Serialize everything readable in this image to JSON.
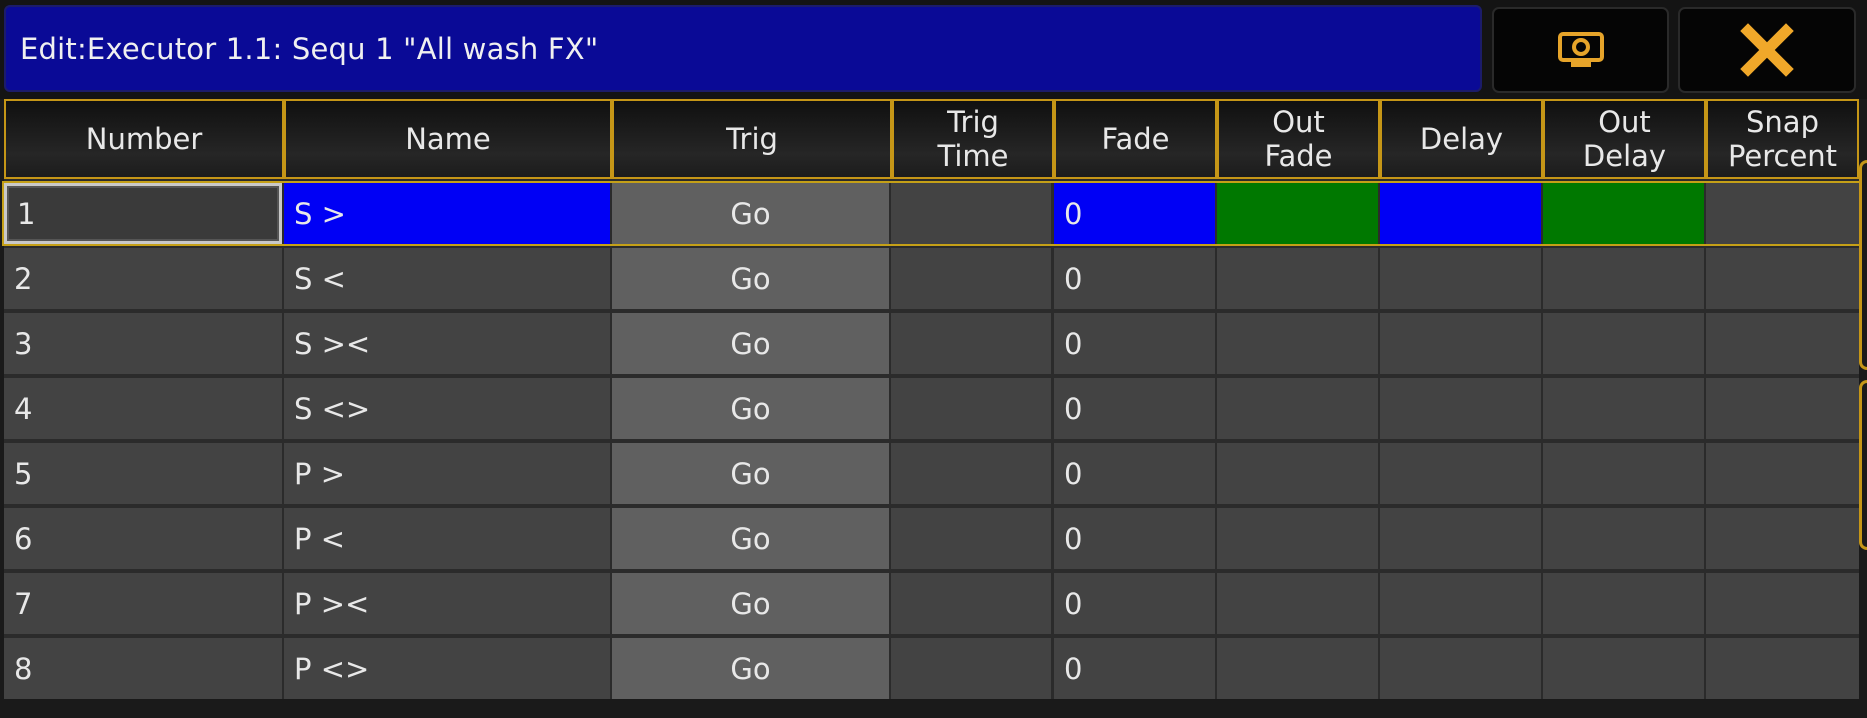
{
  "window": {
    "title": "Edit:Executor 1.1: Sequ 1 \"All wash FX\"",
    "view_button_icon": "view-icon",
    "close_button_icon": "close-icon"
  },
  "columns": [
    {
      "key": "number",
      "label": "Number"
    },
    {
      "key": "name",
      "label": "Name"
    },
    {
      "key": "trig",
      "label": "Trig"
    },
    {
      "key": "trig_time",
      "label": "Trig\nTime"
    },
    {
      "key": "fade",
      "label": "Fade"
    },
    {
      "key": "out_fade",
      "label": "Out\nFade"
    },
    {
      "key": "delay",
      "label": "Delay"
    },
    {
      "key": "out_delay",
      "label": "Out\nDelay"
    },
    {
      "key": "snap_percent",
      "label": "Snap\nPercent"
    }
  ],
  "rows": [
    {
      "number": "1",
      "name": "S >",
      "trig": "Go",
      "trig_time": "",
      "fade": "0",
      "out_fade": "",
      "delay": "",
      "out_delay": "",
      "snap_percent": ""
    },
    {
      "number": "2",
      "name": "S <",
      "trig": "Go",
      "trig_time": "",
      "fade": "0",
      "out_fade": "",
      "delay": "",
      "out_delay": "",
      "snap_percent": ""
    },
    {
      "number": "3",
      "name": "S ><",
      "trig": "Go",
      "trig_time": "",
      "fade": "0",
      "out_fade": "",
      "delay": "",
      "out_delay": "",
      "snap_percent": ""
    },
    {
      "number": "4",
      "name": "S <>",
      "trig": "Go",
      "trig_time": "",
      "fade": "0",
      "out_fade": "",
      "delay": "",
      "out_delay": "",
      "snap_percent": ""
    },
    {
      "number": "5",
      "name": "P >",
      "trig": "Go",
      "trig_time": "",
      "fade": "0",
      "out_fade": "",
      "delay": "",
      "out_delay": "",
      "snap_percent": ""
    },
    {
      "number": "6",
      "name": "P <",
      "trig": "Go",
      "trig_time": "",
      "fade": "0",
      "out_fade": "",
      "delay": "",
      "out_delay": "",
      "snap_percent": ""
    },
    {
      "number": "7",
      "name": "P ><",
      "trig": "Go",
      "trig_time": "",
      "fade": "0",
      "out_fade": "",
      "delay": "",
      "out_delay": "",
      "snap_percent": ""
    },
    {
      "number": "8",
      "name": "P <>",
      "trig": "Go",
      "trig_time": "",
      "fade": "0",
      "out_fade": "",
      "delay": "",
      "out_delay": "",
      "snap_percent": ""
    }
  ],
  "colors": {
    "title_bg": "#0a0a96",
    "header_border": "#c59617",
    "selected_blue": "#0000f5",
    "selected_green": "#007800",
    "cell_bg": "#434343",
    "trig_bg": "#606060",
    "icon_accent": "#e6a42a"
  }
}
